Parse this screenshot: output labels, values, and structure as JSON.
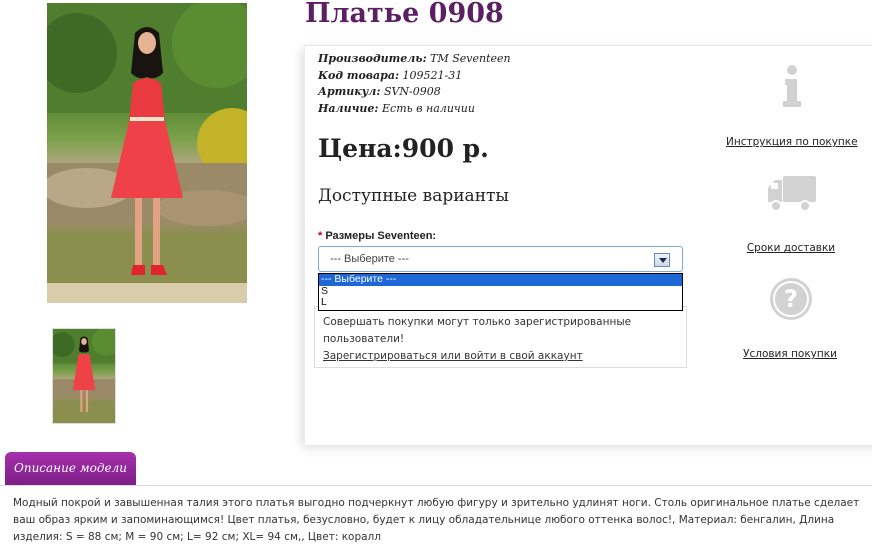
{
  "product": {
    "title": "Платье 0908",
    "meta": [
      {
        "label": "Производитель:",
        "value": "TM Seventeen"
      },
      {
        "label": "Код товара:",
        "value": "109521-31"
      },
      {
        "label": "Артикул:",
        "value": "SVN-0908"
      },
      {
        "label": "Наличие:",
        "value": "Есть в наличии"
      }
    ],
    "price": "Цена:900 р.",
    "variants_heading": "Доступные варианты",
    "size_option": {
      "required_mark": "*",
      "label": "Размеры Seventeen:",
      "selected": "--- Выберите ---",
      "options": [
        "--- Выберите ---",
        "S",
        "L"
      ]
    },
    "notice": {
      "text": "Совершать покупки могут только зарегистрированные пользователи!",
      "link": "Зарегистрироваться или войти в свой аккаунт"
    }
  },
  "sidebar": {
    "items": [
      {
        "icon": "info-icon",
        "label": "Инструкция по покупке"
      },
      {
        "icon": "truck-icon",
        "label": "Сроки доставки"
      },
      {
        "icon": "question-icon",
        "label": "Условия покупки"
      }
    ]
  },
  "description": {
    "tab_label": "Описание модели",
    "text": "Модный покрой и завышенная талия этого платья выгодно подчеркнут любую фигуру и зрительно удлинят ноги. Столь оригинальное платье сделает ваш образ ярким и запоминающимся! Цвет платья, безусловно, будет к лицу обладательнице любого оттенка волос!, Материал: бенгалин, Длина изделия: S = 88 см; M = 90 см; L= 92 см; XL= 94 см,, Цвет: коралл"
  },
  "colors": {
    "title": "#5b1f63",
    "tab": "#8e2698",
    "dropdown_highlight": "#1e67d6",
    "dress": "#e83a3f"
  }
}
